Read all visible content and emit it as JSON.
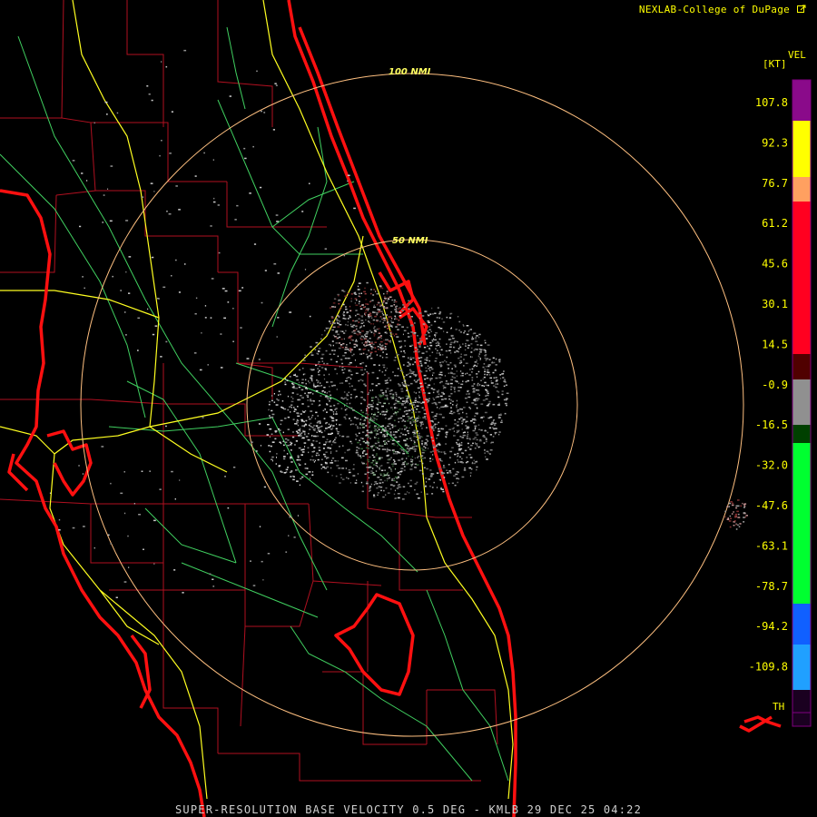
{
  "header": {
    "credit": "NEXLAB-College of DuPage",
    "credit_icon": "external-link-icon"
  },
  "footer": {
    "product": "SUPER-RESOLUTION BASE VELOCITY",
    "elevation": "0.5 DEG",
    "separator": "-",
    "station": "KMLB",
    "timestamp": "29 DEC 25 04:22"
  },
  "range_rings": [
    {
      "label": "100 NMI",
      "range_nmi": 100
    },
    {
      "label": "50 NMI",
      "range_nmi": 50
    }
  ],
  "legend": {
    "title": "VEL",
    "unit": "[KT]",
    "tick_labels": [
      "107.8",
      "92.3",
      "76.7",
      "61.2",
      "45.6",
      "30.1",
      "14.5",
      "-0.9",
      "-16.5",
      "-32.0",
      "-47.6",
      "-63.1",
      "-78.7",
      "-94.2",
      "-109.8"
    ],
    "th_label": "TH",
    "colors": {
      "purple": "#8a0a8a",
      "yellow": "#ffff00",
      "orange": "#ffa060",
      "red": "#ff0020",
      "dark_red": "#500000",
      "gray": "#909090",
      "dark_green": "#004000",
      "green": "#00ff30",
      "blue": "#1060ff",
      "cyan": "#20a0ff",
      "th": "#1a0020"
    }
  },
  "map_colors": {
    "coastline": "#ff1010",
    "county_lines": "#b01020",
    "highways": "#ffff20",
    "roads": "#40d060",
    "range_ring": "#ffc080",
    "range_label": "#ffff60"
  }
}
